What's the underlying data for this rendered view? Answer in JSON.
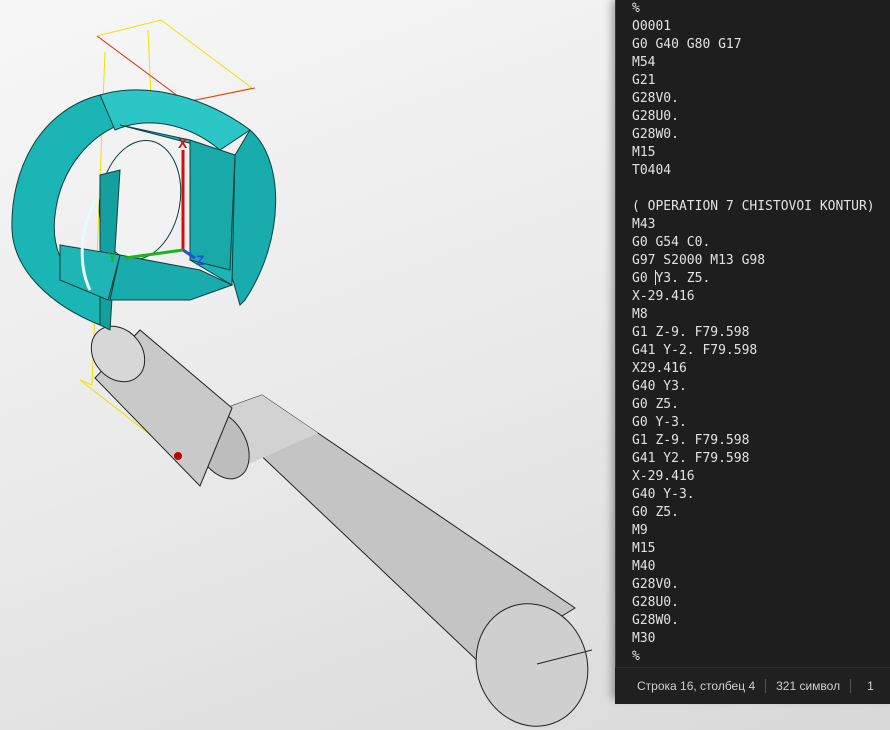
{
  "viewport": {
    "axis_labels": {
      "x": "X",
      "y": "Y",
      "z": "Z"
    },
    "colors": {
      "part_fill": "#1bb5b5",
      "part_top": "#2cc6c6",
      "part_side": "#17a3a3",
      "shaft_body": "#c8c8c8",
      "toolpath": "#f0e000",
      "boundary": "#e03030",
      "axis_x": "#d01010",
      "axis_y": "#20b020",
      "axis_z": "#2050e0"
    }
  },
  "editor": {
    "lines": [
      "%",
      "O0001",
      "G0 G40 G80 G17",
      "M54",
      "G21",
      "G28V0.",
      "G28U0.",
      "G28W0.",
      "M15",
      "T0404",
      "",
      "( OPERATION 7 CHISTOVOI KONTUR)",
      "M43",
      "G0 G54 C0.",
      "G97 S2000 M13 G98",
      "G0 Y3. Z5.",
      "X-29.416",
      "M8",
      "G1 Z-9. F79.598",
      "G41 Y-2. F79.598",
      "X29.416",
      "G40 Y3.",
      "G0 Z5.",
      "G0 Y-3.",
      "G1 Z-9. F79.598",
      "G41 Y2. F79.598",
      "X-29.416",
      "G40 Y-3.",
      "G0 Z5.",
      "M9",
      "M15",
      "M40",
      "G28V0.",
      "G28U0.",
      "G28W0.",
      "M30",
      "%"
    ],
    "caret_line": 15,
    "caret_col": 3
  },
  "statusbar": {
    "cursor": "Строка 16, столбец 4",
    "chars": "321 символ",
    "extra": "1"
  }
}
